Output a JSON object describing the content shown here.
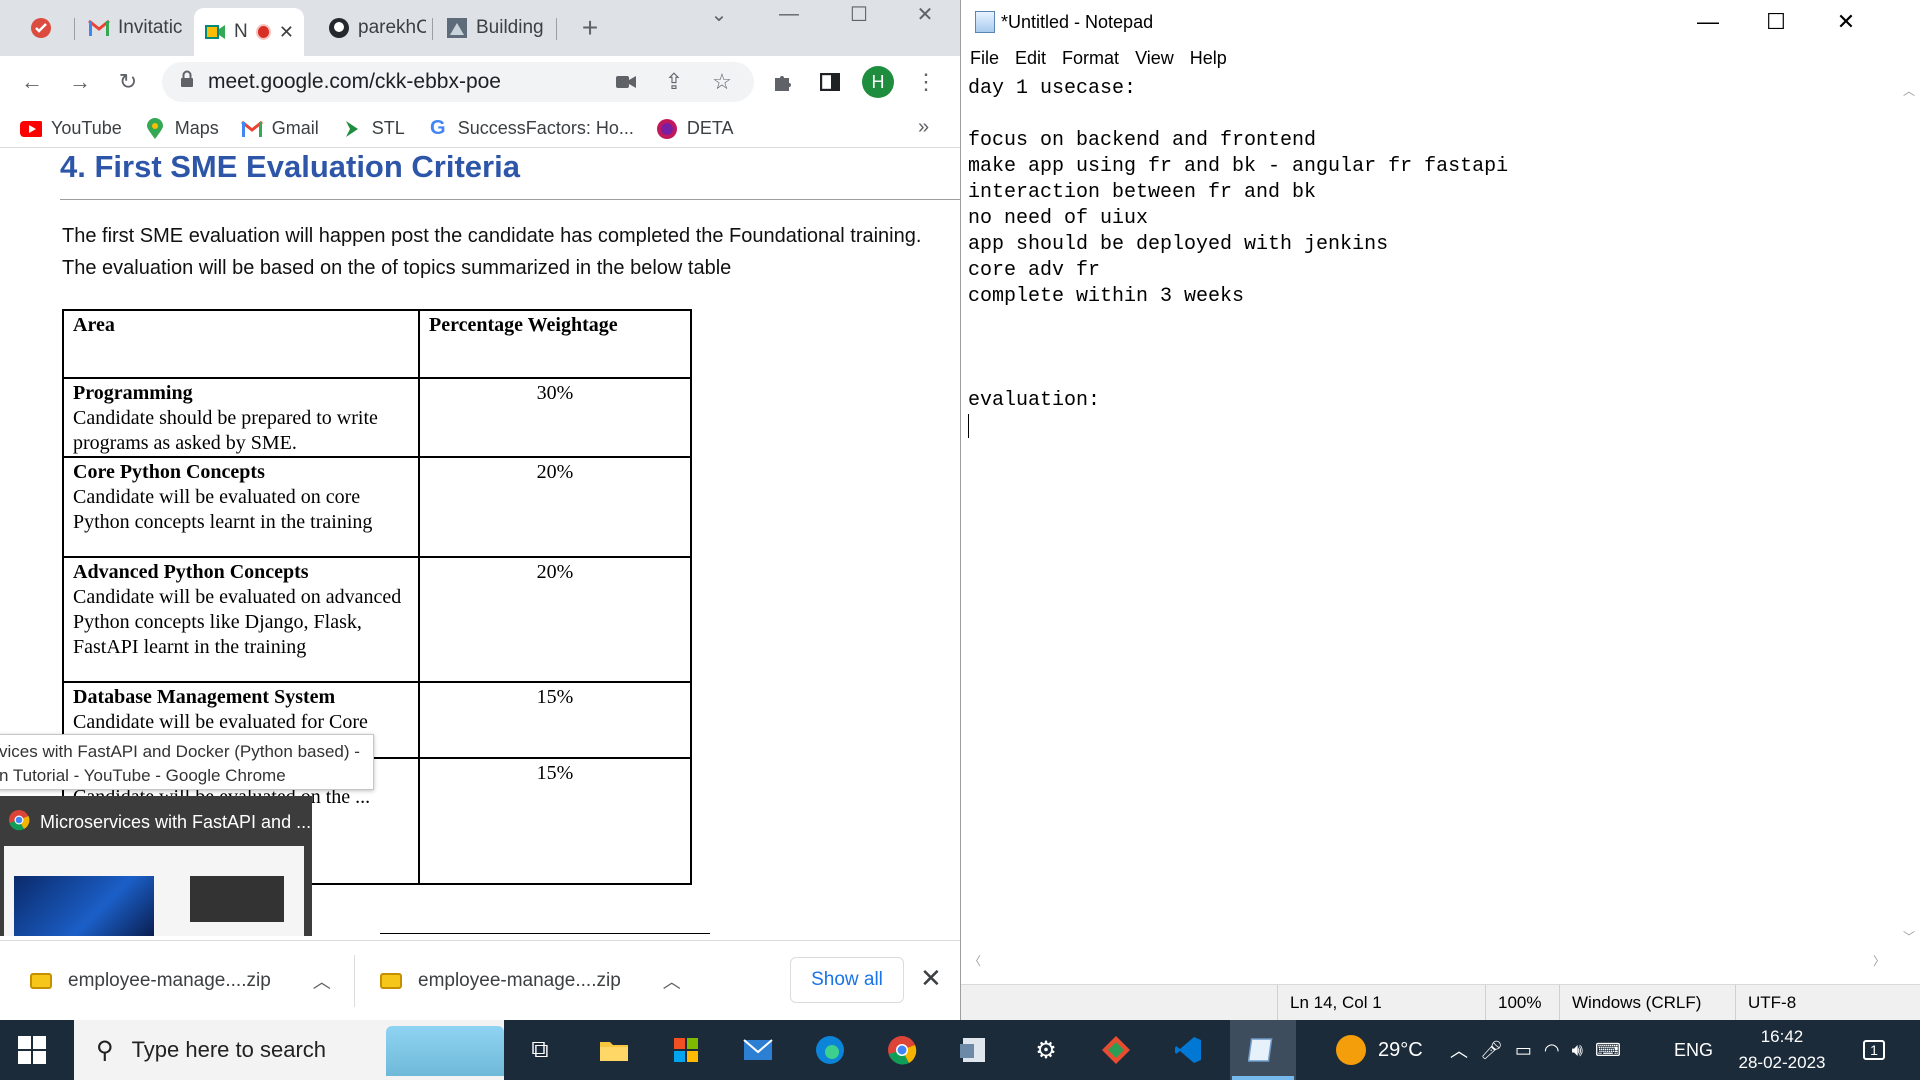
{
  "browser": {
    "tabs": [
      {
        "label": "",
        "icon": "todo-check-icon"
      },
      {
        "label": "Invitatic",
        "icon": "gmail-icon"
      },
      {
        "label": "N",
        "icon": "google-meet-icon",
        "active": true
      },
      {
        "label": "parekhC",
        "icon": "github-icon"
      },
      {
        "label": "Building",
        "icon": "page-thumbnail-icon"
      }
    ],
    "new_tab": "+",
    "url": "meet.google.com/ckk-ebbx-poe",
    "profile_initial": "H",
    "bookmarks": [
      {
        "label": "YouTube",
        "icon": "youtube-icon",
        "color": "#ff0000"
      },
      {
        "label": "Maps",
        "icon": "maps-pin-icon",
        "color": "#34a853"
      },
      {
        "label": "Gmail",
        "icon": "gmail-icon",
        "color": "#ea4335"
      },
      {
        "label": "STL",
        "icon": "stl-chevron-icon",
        "color": "#1e8e3e"
      },
      {
        "label": "SuccessFactors: Ho...",
        "icon": "google-g-icon",
        "color": "#4285f4"
      },
      {
        "label": "DETA",
        "icon": "deta-circle-icon",
        "color": "#c2185b"
      }
    ],
    "bookmarks_overflow": "»",
    "document": {
      "heading": "4. First SME Evaluation Criteria",
      "para1": "The first SME evaluation will happen post the candidate has completed the Foundational training.",
      "para2": "The evaluation will be based on the of topics summarized in the below table",
      "table": {
        "headers": [
          "Area",
          "Percentage Weightage"
        ],
        "rows": [
          {
            "title": "Programming",
            "desc": "Candidate should be prepared to write programs as asked by SME.",
            "pct": "30%"
          },
          {
            "title": "Core Python Concepts",
            "desc": "Candidate will be evaluated on core Python concepts learnt in the training",
            "pct": "20%"
          },
          {
            "title": "Advanced Python Concepts",
            "desc": "Candidate will be evaluated on advanced Python concepts like Django, Flask, FastAPI learnt in the training",
            "pct": "20%"
          },
          {
            "title": "Database Management System",
            "desc": "Candidate will be evaluated for Core",
            "pct": "15%"
          },
          {
            "title": "",
            "desc": "Candidate will be evaluated on the ... gular or ... rnt in the",
            "pct": "15%"
          }
        ]
      }
    },
    "tooltip": {
      "line1": "vices with FastAPI and Docker (Python based) -",
      "line2": "n Tutorial - YouTube - Google Chrome"
    },
    "preview_title": "Microservices with FastAPI and ...",
    "downloads": [
      {
        "name": "employee-manage....zip"
      },
      {
        "name": "employee-manage....zip"
      }
    ],
    "show_all": "Show all"
  },
  "notepad": {
    "title": "*Untitled - Notepad",
    "menu": [
      "File",
      "Edit",
      "Format",
      "View",
      "Help"
    ],
    "lines": [
      "day 1 usecase:",
      "",
      "focus on backend and frontend",
      "make app using fr and bk - angular fr fastapi",
      "interaction between fr and bk",
      "no need of uiux",
      "app should be deployed with jenkins",
      "core adv fr",
      "complete within 3 weeks",
      "",
      "",
      "",
      "evaluation:",
      ""
    ],
    "status": {
      "position": "Ln 14, Col 1",
      "zoom": "100%",
      "line_endings": "Windows (CRLF)",
      "encoding": "UTF-8"
    }
  },
  "taskbar": {
    "search_placeholder": "Type here to search",
    "weather": "29°C",
    "language": "ENG",
    "time": "16:42",
    "date": "28-02-2023",
    "notifications": "1"
  }
}
